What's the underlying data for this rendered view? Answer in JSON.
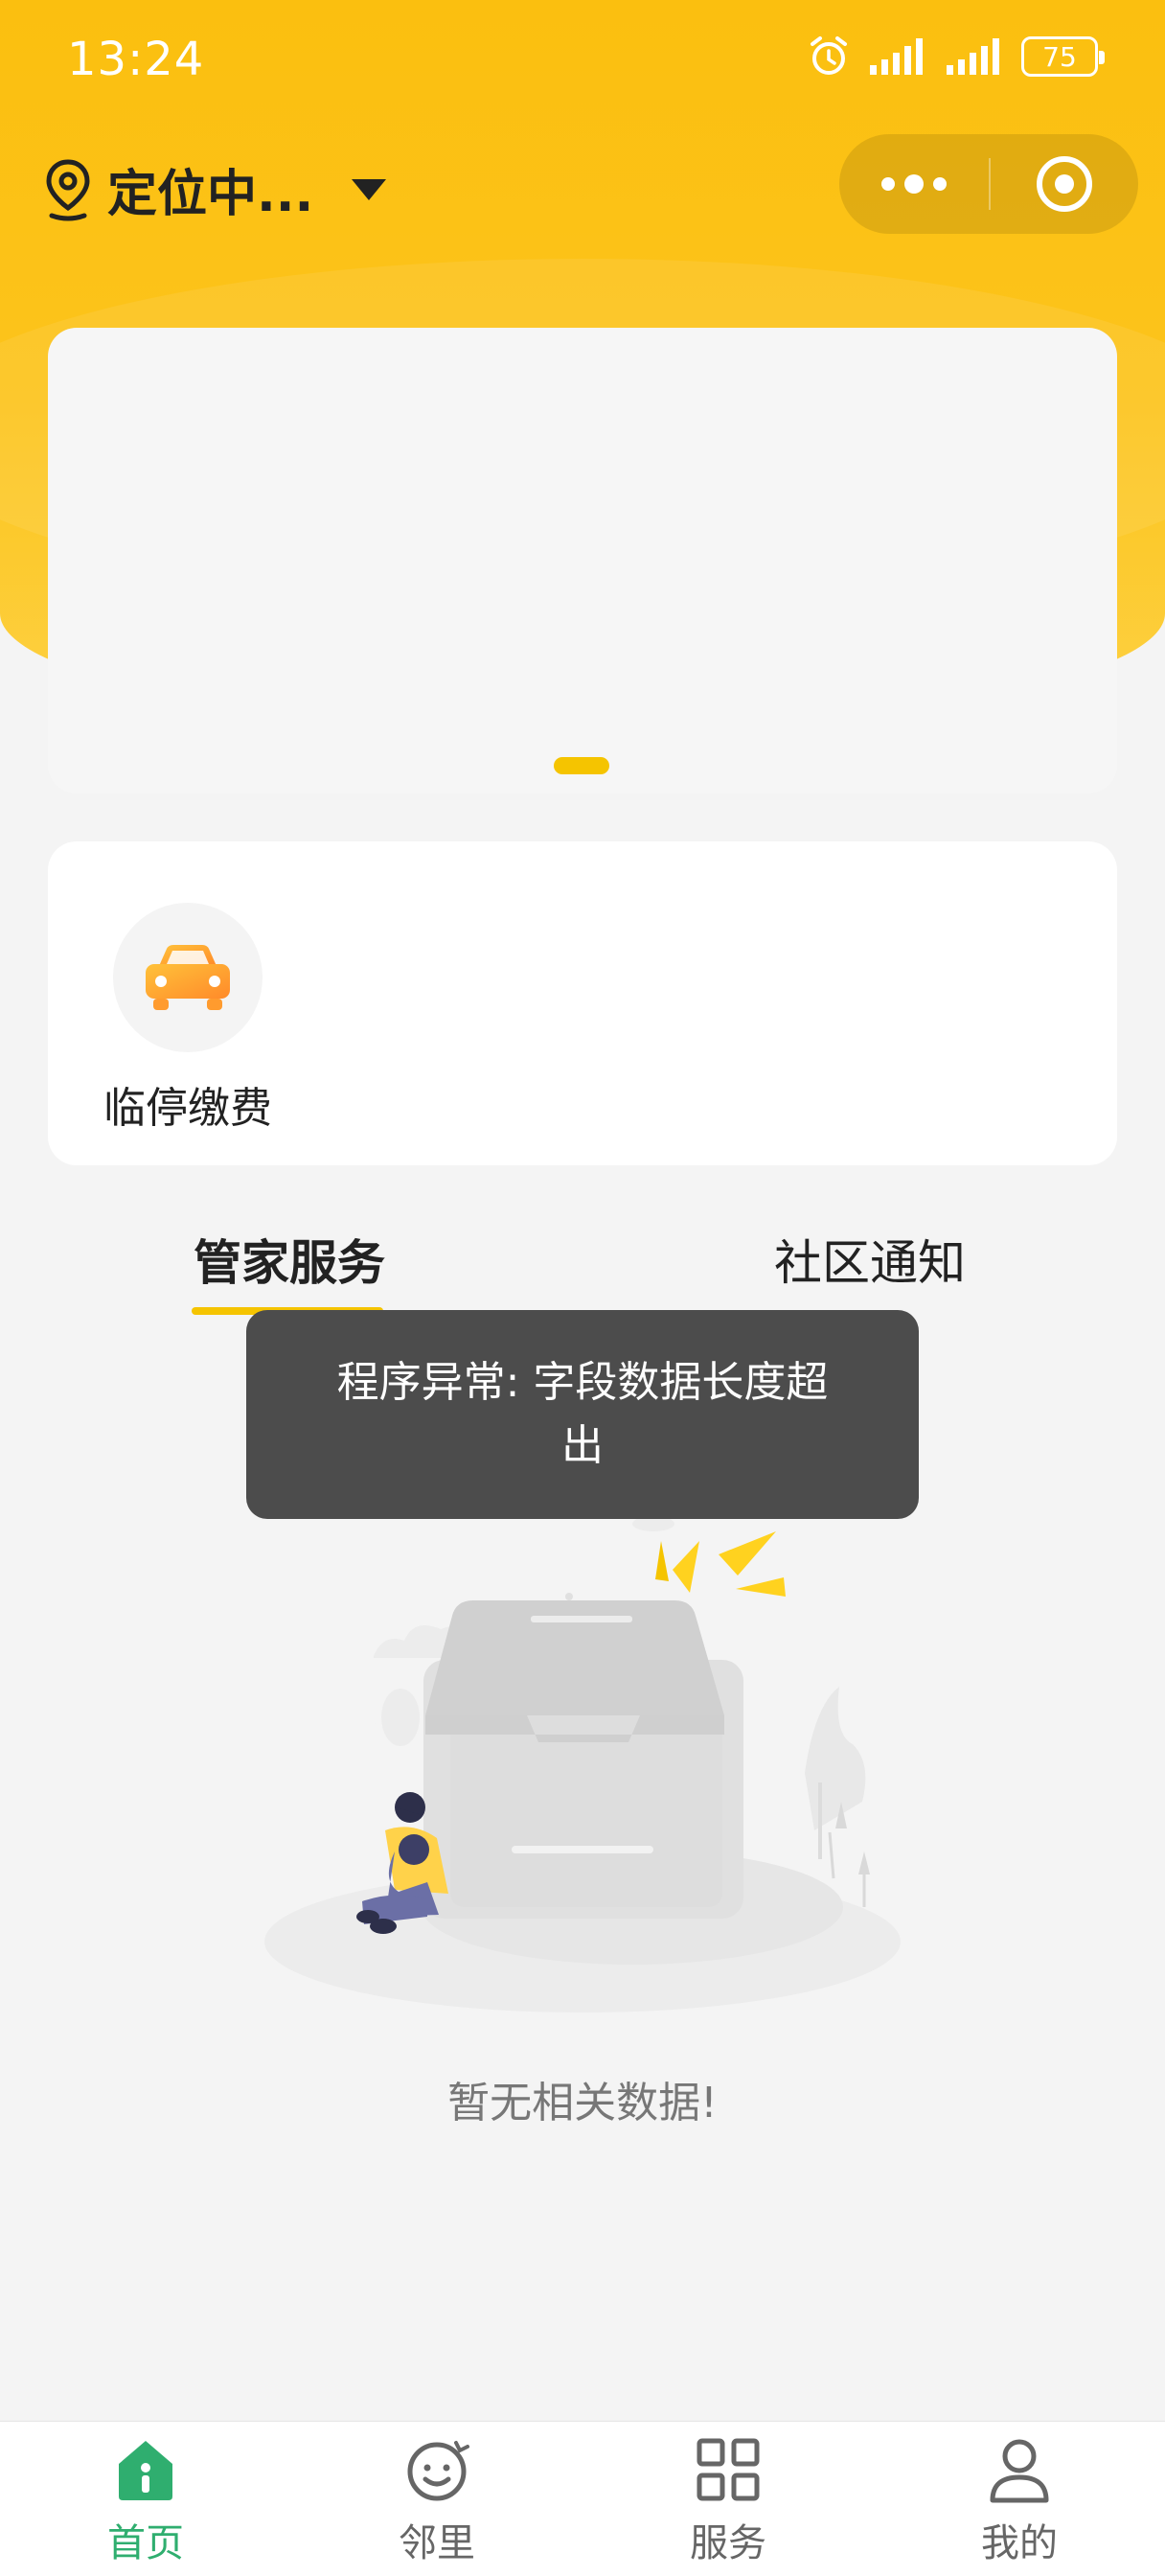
{
  "status_bar": {
    "time": "13:24",
    "battery": "75",
    "icons": [
      "alarm-icon",
      "signal-icon",
      "signal-icon",
      "battery-icon"
    ]
  },
  "header": {
    "location_label": "定位中...",
    "location_icon": "location-pin-icon",
    "capsule_icons": [
      "more-icon",
      "close-miniprogram-icon"
    ]
  },
  "banner": {
    "indicator_color": "#f5c400"
  },
  "quick_services": [
    {
      "label": "临停缴费",
      "icon": "car-icon"
    }
  ],
  "tabs": [
    {
      "label": "管家服务",
      "active": true
    },
    {
      "label": "社区通知",
      "active": false
    }
  ],
  "toast": {
    "message": "程序异常: 字段数据长度超出"
  },
  "empty_state": {
    "text": "暂无相关数据!"
  },
  "tabbar": [
    {
      "label": "首页",
      "icon": "home-icon",
      "active": true
    },
    {
      "label": "邻里",
      "icon": "smiley-icon",
      "active": false
    },
    {
      "label": "服务",
      "icon": "grid-icon",
      "active": false
    },
    {
      "label": "我的",
      "icon": "person-icon",
      "active": false
    }
  ],
  "colors": {
    "header_yellow": "#fbbf0f",
    "accent_yellow": "#f5c400",
    "active_green": "#2fae6f",
    "toast_bg": "#4c4c4c"
  }
}
